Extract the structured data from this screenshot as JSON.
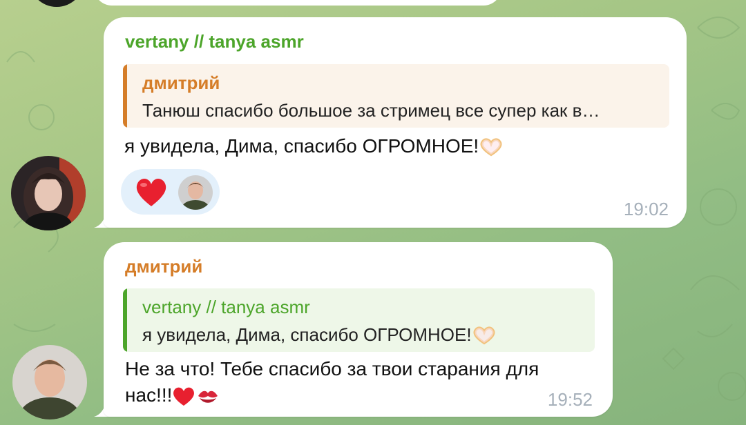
{
  "colors": {
    "green_name": "#4ca52a",
    "orange_name": "#d57d28",
    "quote_orange_bg": "#fbf3ea",
    "quote_green_bg": "#eef7e8",
    "bubble_bg": "#ffffff",
    "time": "#a6b0ba"
  },
  "messages": [
    {
      "sender": "vertany // tanya asmr",
      "reply": {
        "name": "дмитрий",
        "text": "Танюш спасибо большое за стримец все супер как в…"
      },
      "text": "я увидела, Дима, спасибо ОГРОМНОЕ!",
      "emoji": "heart-hands",
      "reactions": [
        {
          "icon": "red-heart"
        }
      ],
      "time": "19:02"
    },
    {
      "sender": "дмитрий",
      "reply": {
        "name": "vertany // tanya asmr",
        "text": "я увидела, Дима, спасибо ОГРОМНОЕ!"
      },
      "text_line1": "Не за что! Тебе спасибо за твои старания для",
      "text_line2": "нас!!!",
      "emojis": [
        "red-heart",
        "kiss-mark"
      ],
      "time": "19:52"
    }
  ]
}
